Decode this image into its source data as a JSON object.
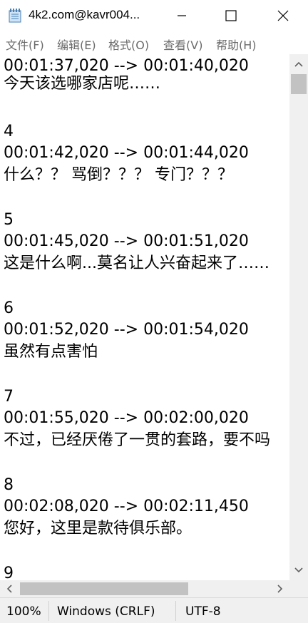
{
  "window": {
    "title": "4k2.com@kavr004...",
    "icons": {
      "app": "notepad-icon",
      "minimize": "minimize-icon",
      "maximize": "maximize-icon",
      "close": "close-icon"
    }
  },
  "menu": [
    {
      "label": "文件(F)"
    },
    {
      "label": "编辑(E)"
    },
    {
      "label": "格式(O)"
    },
    {
      "label": "查看(V)"
    },
    {
      "label": "帮助(H)"
    }
  ],
  "editor": {
    "lines": [
      "00:01:37,020 --> 00:01:40,020",
      "今天该选哪家店呢……",
      "",
      "4",
      "00:01:42,020 --> 00:01:44,020",
      "什么？？ 骂倒？？？ 专门？？？",
      "",
      "5",
      "00:01:45,020 --> 00:01:51,020",
      "这是什么啊...莫名让人兴奋起来了……",
      "",
      "6",
      "00:01:52,020 --> 00:01:54,020",
      "虽然有点害怕",
      "",
      "7",
      "00:01:55,020 --> 00:02:00,020",
      "不过，已经厌倦了一贯的套路，要不吗",
      "",
      "8",
      "00:02:08,020 --> 00:02:11,450",
      "您好，这里是款待俱乐部。",
      "",
      "9"
    ]
  },
  "scrollbars": {
    "icons": {
      "up": "scroll-up-arrow-icon",
      "down": "scroll-down-arrow-icon",
      "left": "scroll-left-arrow-icon",
      "right": "scroll-right-arrow-icon"
    }
  },
  "status": {
    "zoom": "100%",
    "line_ending": "Windows (CRLF)",
    "encoding": "UTF-8"
  },
  "colors": {
    "menu_text": "#6b6b6b",
    "status_bg": "#f0f0f0",
    "scroll_thumb": "#c2c2c2"
  }
}
